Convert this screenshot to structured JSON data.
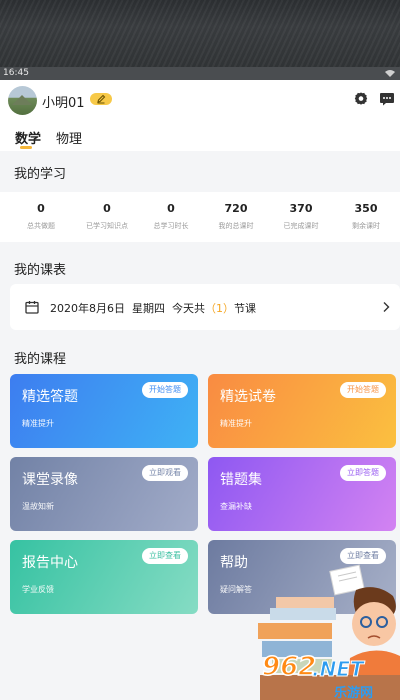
{
  "status_bar": {
    "time": "16:45"
  },
  "header": {
    "username": "小明01",
    "tabs": [
      "数学",
      "物理"
    ]
  },
  "sections": {
    "my_study": "我的学习",
    "my_schedule": "我的课表",
    "my_courses": "我的课程"
  },
  "stats": [
    {
      "value": "0",
      "label": "总共做题"
    },
    {
      "value": "0",
      "label": "已学习知识点"
    },
    {
      "value": "0",
      "label": "总学习时长"
    },
    {
      "value": "720",
      "label": "我的总课时"
    },
    {
      "value": "370",
      "label": "已完成课时"
    },
    {
      "value": "350",
      "label": "剩余课时"
    }
  ],
  "schedule": {
    "date": "2020年8月6日",
    "weekday": "星期四",
    "today_prefix": "今天共",
    "count": "（1）",
    "suffix": "节课"
  },
  "courses": [
    {
      "title": "精选答题",
      "subtitle": "精准提升",
      "button": "开始答题"
    },
    {
      "title": "精选试卷",
      "subtitle": "精准提升",
      "button": "开始答题"
    },
    {
      "title": "课堂录像",
      "subtitle": "温故知新",
      "button": "立即观看"
    },
    {
      "title": "错题集",
      "subtitle": "查漏补缺",
      "button": "立即答题"
    },
    {
      "title": "报告中心",
      "subtitle": "学业反馈",
      "button": "立即查看"
    },
    {
      "title": "帮助",
      "subtitle": "疑问解答",
      "button": "立即查看"
    }
  ],
  "watermark": {
    "number": "962",
    "suffix": ".NET",
    "cn": "乐游网"
  },
  "icons": {
    "settings": "gear-icon",
    "messages": "chat-icon",
    "edit": "pencil-icon",
    "calendar": "calendar-icon",
    "arrow": "chevron-right-icon"
  },
  "colors": {
    "accent": "#f5b63a",
    "blue": "#3d8df2",
    "orange": "#f9a043",
    "purple": "#a56af2",
    "teal": "#4cc8aa",
    "slate": "#7f8bab"
  }
}
